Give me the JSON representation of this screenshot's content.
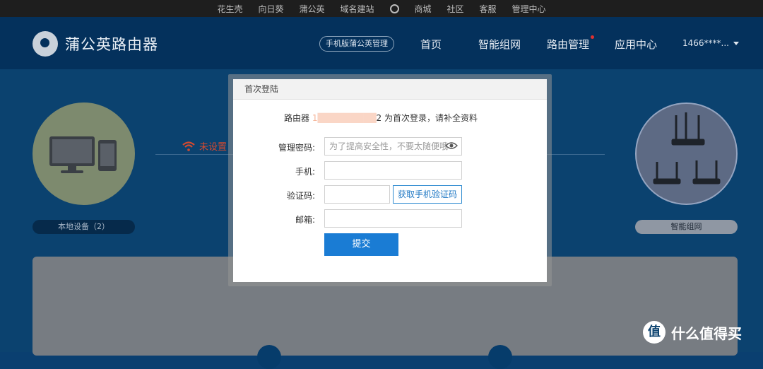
{
  "topbar": {
    "items": [
      "花生壳",
      "向日葵",
      "蒲公英",
      "域名建站",
      "商城",
      "社区",
      "客服",
      "管理中心"
    ]
  },
  "header": {
    "logo_text": "蒲公英路由器",
    "mobile_manage": "手机版蒲公英管理",
    "nav": [
      "首页",
      "智能组网",
      "路由管理",
      "应用中心"
    ],
    "account": "1466****..."
  },
  "background": {
    "local_devices": "本地设备（2）",
    "wifi_status": "未设置",
    "smart_network": "智能组网"
  },
  "dialog": {
    "title": "首次登陆",
    "intro_prefix": "路由器",
    "intro_masked": "1",
    "intro_suffix": "2 为首次登录，请补全资料",
    "fields": {
      "password_label": "管理密码:",
      "password_placeholder": "为了提高安全性，不要太随便哦",
      "phone_label": "手机:",
      "code_label": "验证码:",
      "code_button": "获取手机验证码",
      "email_label": "邮箱:"
    },
    "submit": "提交"
  },
  "watermark": {
    "symbol": "值",
    "text": "什么值得买"
  },
  "colors": {
    "header_bg": "#04315c",
    "accent_blue": "#1a7cd4",
    "status_red": "#d44a2f"
  }
}
